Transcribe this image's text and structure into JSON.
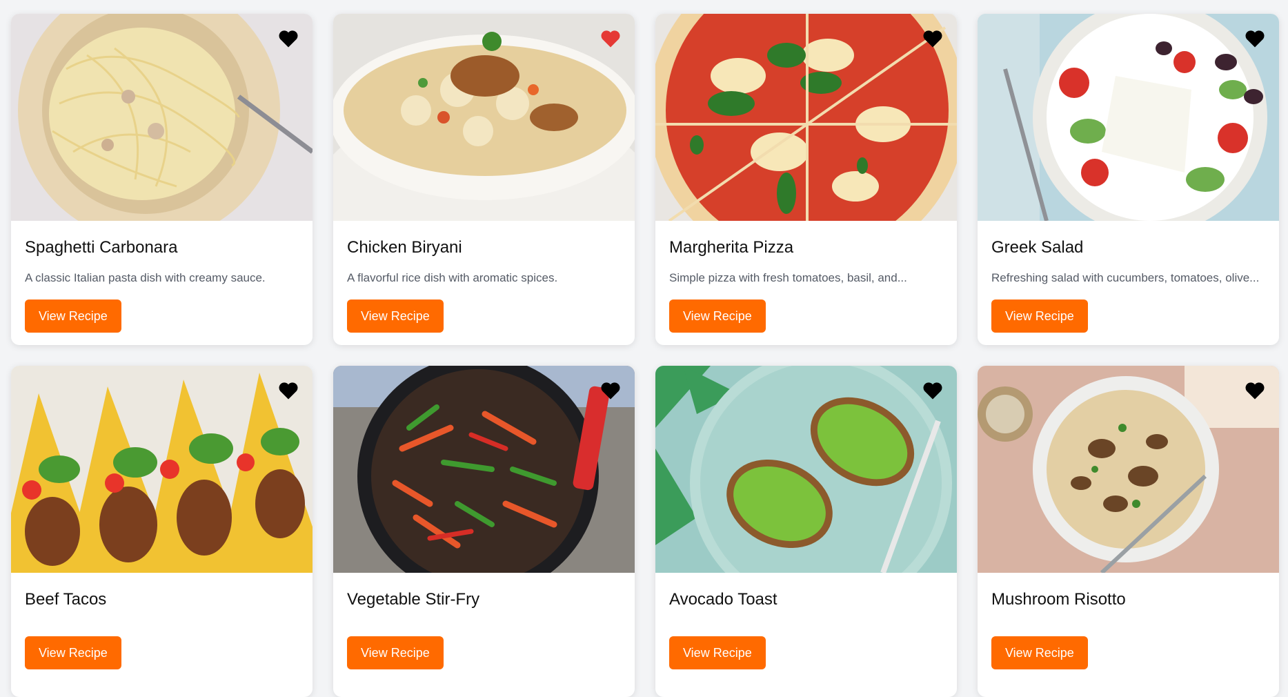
{
  "colors": {
    "accent": "#ff6a00",
    "heart_default": "#000000",
    "heart_favorited": "#e53935"
  },
  "recipes": [
    {
      "title": "Spaghetti Carbonara",
      "description": "A classic Italian pasta dish with creamy sauce.",
      "button": "View Recipe",
      "favorite": false,
      "image_icon": "pasta-image"
    },
    {
      "title": "Chicken Biryani",
      "description": "A flavorful rice dish with aromatic spices.",
      "button": "View Recipe",
      "favorite": true,
      "image_icon": "biryani-image"
    },
    {
      "title": "Margherita Pizza",
      "description": "Simple pizza with fresh tomatoes, basil, and...",
      "button": "View Recipe",
      "favorite": false,
      "image_icon": "pizza-image"
    },
    {
      "title": "Greek Salad",
      "description": "Refreshing salad with cucumbers, tomatoes, olive...",
      "button": "View Recipe",
      "favorite": false,
      "image_icon": "salad-image"
    },
    {
      "title": "Beef Tacos",
      "description": "",
      "button": "View Recipe",
      "favorite": false,
      "image_icon": "tacos-image"
    },
    {
      "title": "Vegetable Stir-Fry",
      "description": "",
      "button": "View Recipe",
      "favorite": false,
      "image_icon": "stir-fry-image"
    },
    {
      "title": "Avocado Toast",
      "description": "",
      "button": "View Recipe",
      "favorite": false,
      "image_icon": "avocado-toast-image"
    },
    {
      "title": "Mushroom Risotto",
      "description": "",
      "button": "View Recipe",
      "favorite": false,
      "image_icon": "risotto-image"
    }
  ]
}
